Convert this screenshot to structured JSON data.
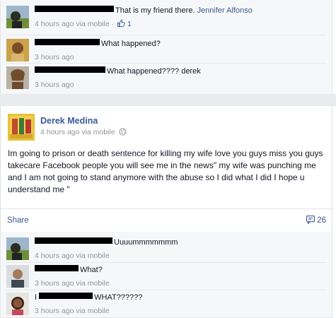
{
  "top_comments": [
    {
      "text": "That is my friend there.",
      "link": "Jennifer Alfonso",
      "time": "4 hours ago",
      "via": "via mobile",
      "likes": "1"
    },
    {
      "text": "What happened?",
      "time": "3 hours ago"
    },
    {
      "text": "What happened???? derek",
      "time": "3 hours ago"
    }
  ],
  "post": {
    "author": "Derek Medina",
    "time": "4 hours ago",
    "via": "via mobile",
    "text": "Im going to prison or death sentence for killing my wife love you guys miss you guys takecare Facebook people you will see me in the news\" my wife was punching me and I am not going to stand anymore with the abuse so I did what I did I hope u understand me \"",
    "share_label": "Share",
    "comment_count": "26"
  },
  "bottom_comments": [
    {
      "text": "Uuuummmmmmm",
      "time": "4 hours ago",
      "via": "via mobile"
    },
    {
      "text": "What?",
      "time": "3 hours ago",
      "via": "via mobile"
    },
    {
      "prefix": "I",
      "text": "WHAT??????",
      "time": "3 hours ago",
      "via": "via mobile"
    }
  ],
  "colors": {
    "link": "#3b5998",
    "meta": "#90949c",
    "comment_bg": "#f6f7f9"
  }
}
